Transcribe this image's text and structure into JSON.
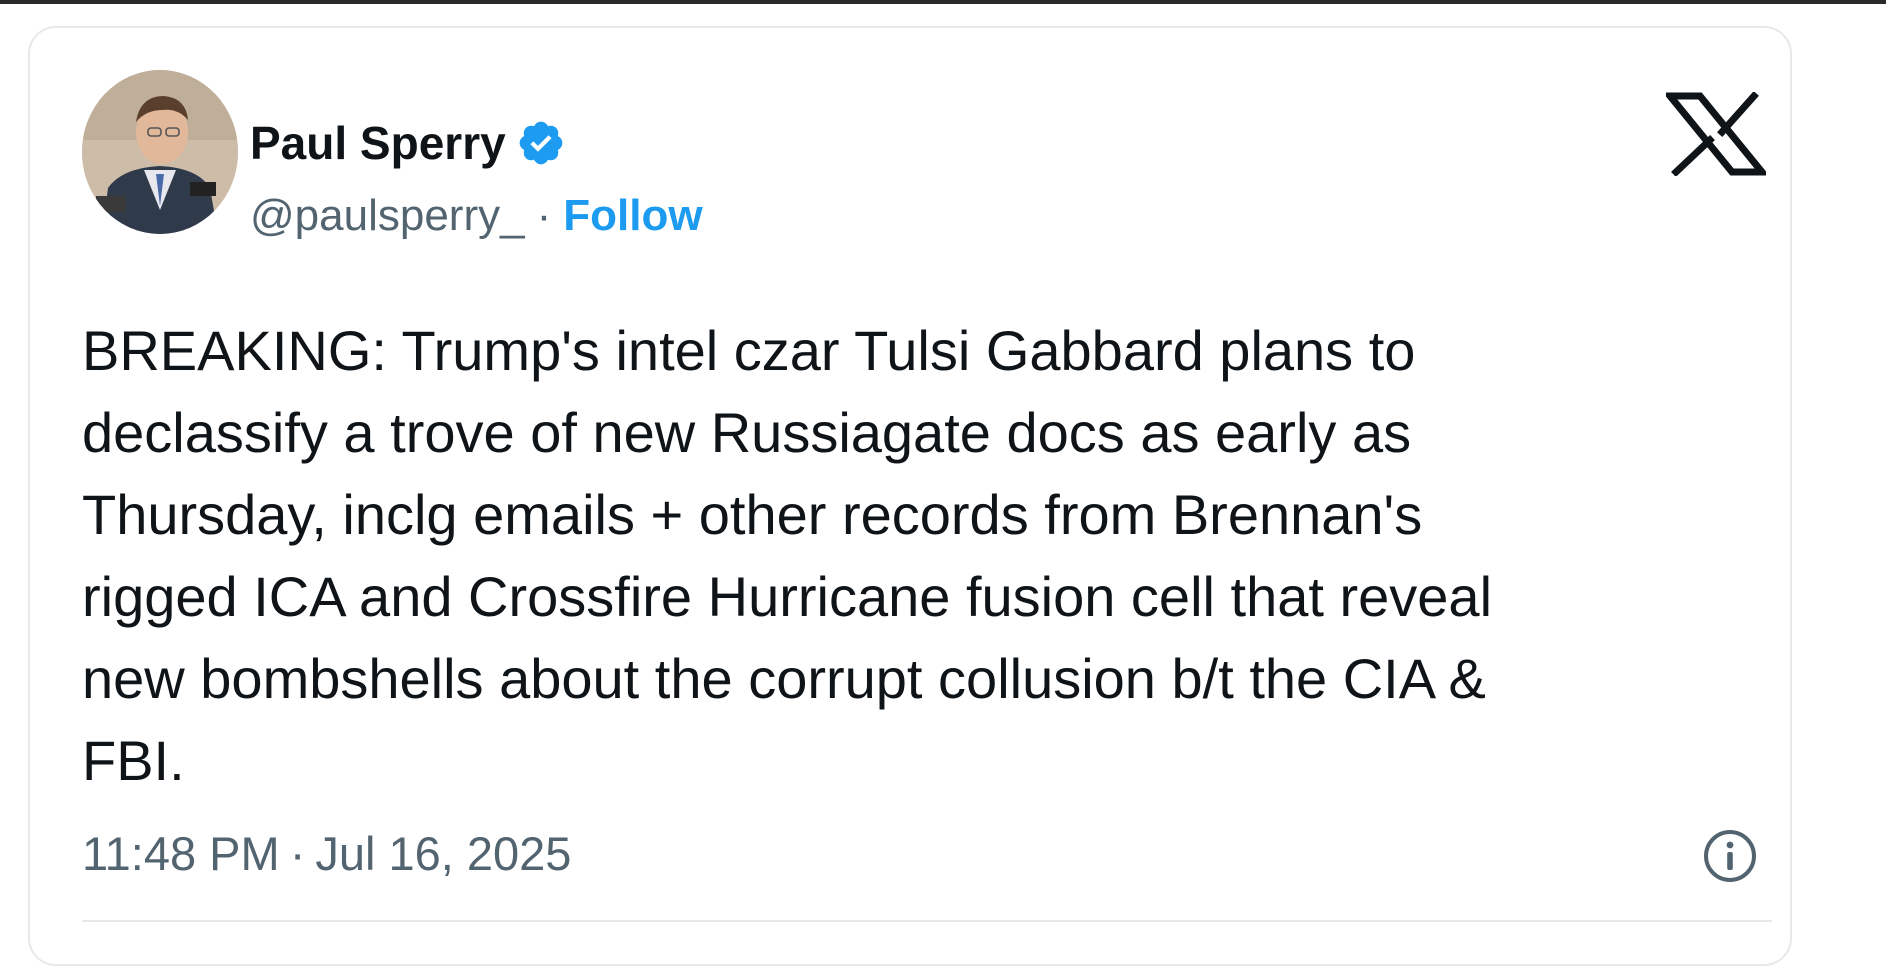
{
  "tweet": {
    "author": {
      "display_name": "Paul Sperry",
      "handle": "@paulsperry_",
      "verified": true,
      "follow_label": "Follow",
      "separator": "·"
    },
    "text": "BREAKING: Trump's intel czar Tulsi Gabbard plans to\ndeclassify a trove of new Russiagate docs as early as\nThursday, inclg emails + other records from Brennan's\nrigged ICA and Crossfire Hurricane fusion cell that reveal\nnew bombshells about the corrupt collusion b/t the CIA &\nFBI.",
    "time": "11:48 PM",
    "date": "Jul 16, 2025",
    "meta_separator": "·"
  },
  "icons": {
    "verified": "verified-badge-icon",
    "brand": "x-logo-icon",
    "info": "info-icon"
  },
  "colors": {
    "accent": "#1d9bf0",
    "text_primary": "#0f1419",
    "text_secondary": "#536471",
    "border": "#e6e8eb"
  }
}
